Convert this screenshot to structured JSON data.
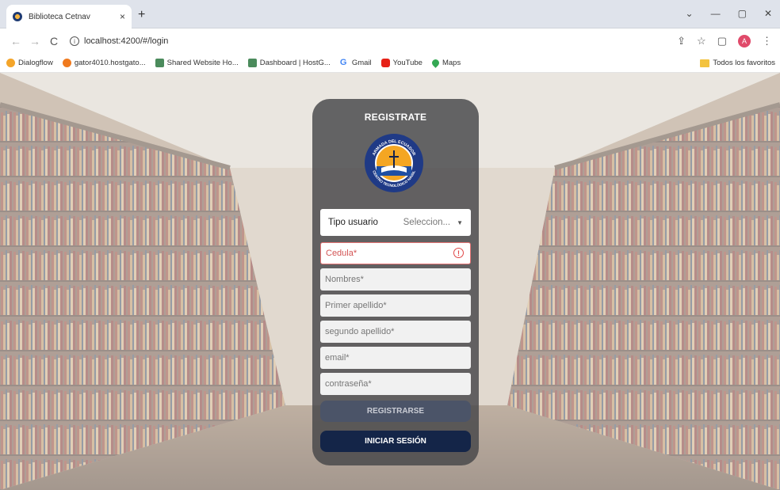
{
  "browser": {
    "tab_title": "Biblioteca Cetnav",
    "tab_close": "×",
    "new_tab": "+",
    "url": "localhost:4200/#/login",
    "nav_back": "←",
    "nav_forward": "→",
    "nav_reload": "C",
    "window_min": "—",
    "window_max": "▢",
    "window_close": "✕",
    "profile_initial": "A"
  },
  "bookmarks": {
    "items": [
      {
        "label": "Dialogflow",
        "color": "#f4a52a"
      },
      {
        "label": "gator4010.hostgato...",
        "color": "#f07a1e"
      },
      {
        "label": "Shared Website Ho...",
        "color": "#4b8b5c"
      },
      {
        "label": "Dashboard | HostG...",
        "color": "#4b8b5c"
      },
      {
        "label": "Gmail",
        "color": "#ea4335"
      },
      {
        "label": "YouTube",
        "color": "#e62117"
      },
      {
        "label": "Maps",
        "color": "#34a853"
      }
    ],
    "all_favorites": "Todos los favoritos"
  },
  "form": {
    "title": "REGISTRATE",
    "logo_text_top": "ARMADA DEL ECUADOR",
    "logo_text_bottom": "CENTRO TECNOLÓGICO NAVAL",
    "tipo_usuario_label": "Tipo usuario",
    "tipo_usuario_value": "Seleccion...",
    "fields": {
      "cedula": "Cedula*",
      "nombres": "Nombres*",
      "primer_apellido": "Primer apellido*",
      "segundo_apellido": "segundo apellido*",
      "email": "email*",
      "contrasena": "contraseña*"
    },
    "error_mark": "!",
    "register_button": "REGISTRARSE",
    "login_button": "INICIAR SESIÓN"
  },
  "colors": {
    "card_bg": "#464648",
    "register_btn": "#4b5468",
    "login_btn": "#142548",
    "error": "#e04646"
  }
}
